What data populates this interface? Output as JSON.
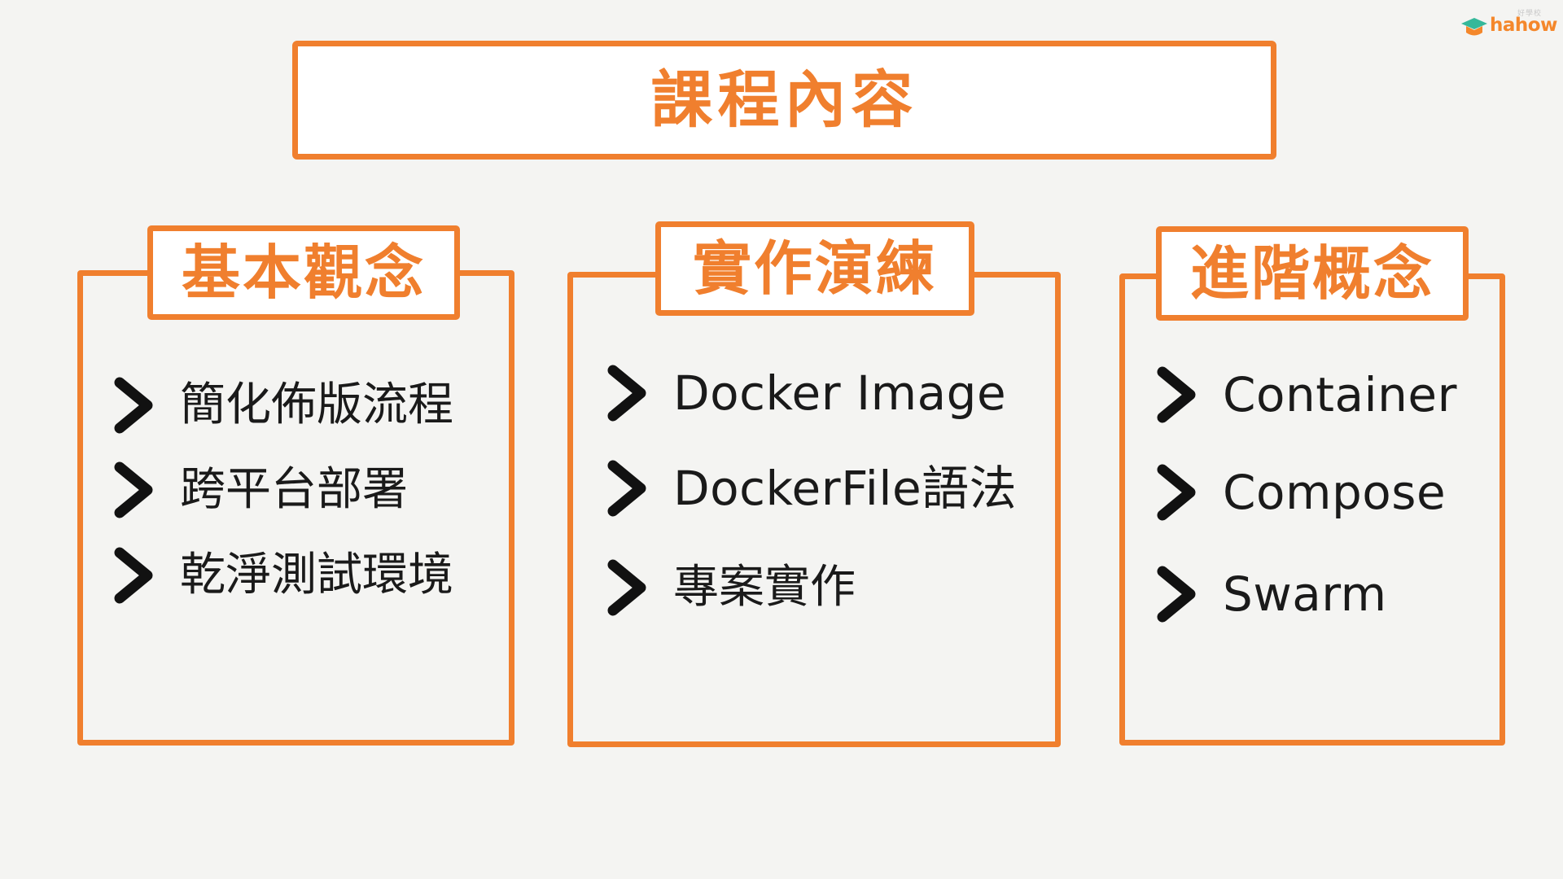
{
  "logo": {
    "wordmark": "hahow",
    "subtitle": "好學校",
    "brand_color": "#f4872b",
    "icon": "graduation-cap-icon"
  },
  "title": "課程內容",
  "accent_color": "#f07f2e",
  "text_color": "#1a1a1a",
  "panels": [
    {
      "heading": "基本觀念",
      "items": [
        "簡化佈版流程",
        "跨平台部署",
        "乾淨測試環境"
      ]
    },
    {
      "heading": "實作演練",
      "items": [
        "Docker Image",
        "DockerFile語法",
        "專案實作"
      ]
    },
    {
      "heading": "進階概念",
      "items": [
        "Container",
        "Compose",
        "Swarm"
      ]
    }
  ]
}
